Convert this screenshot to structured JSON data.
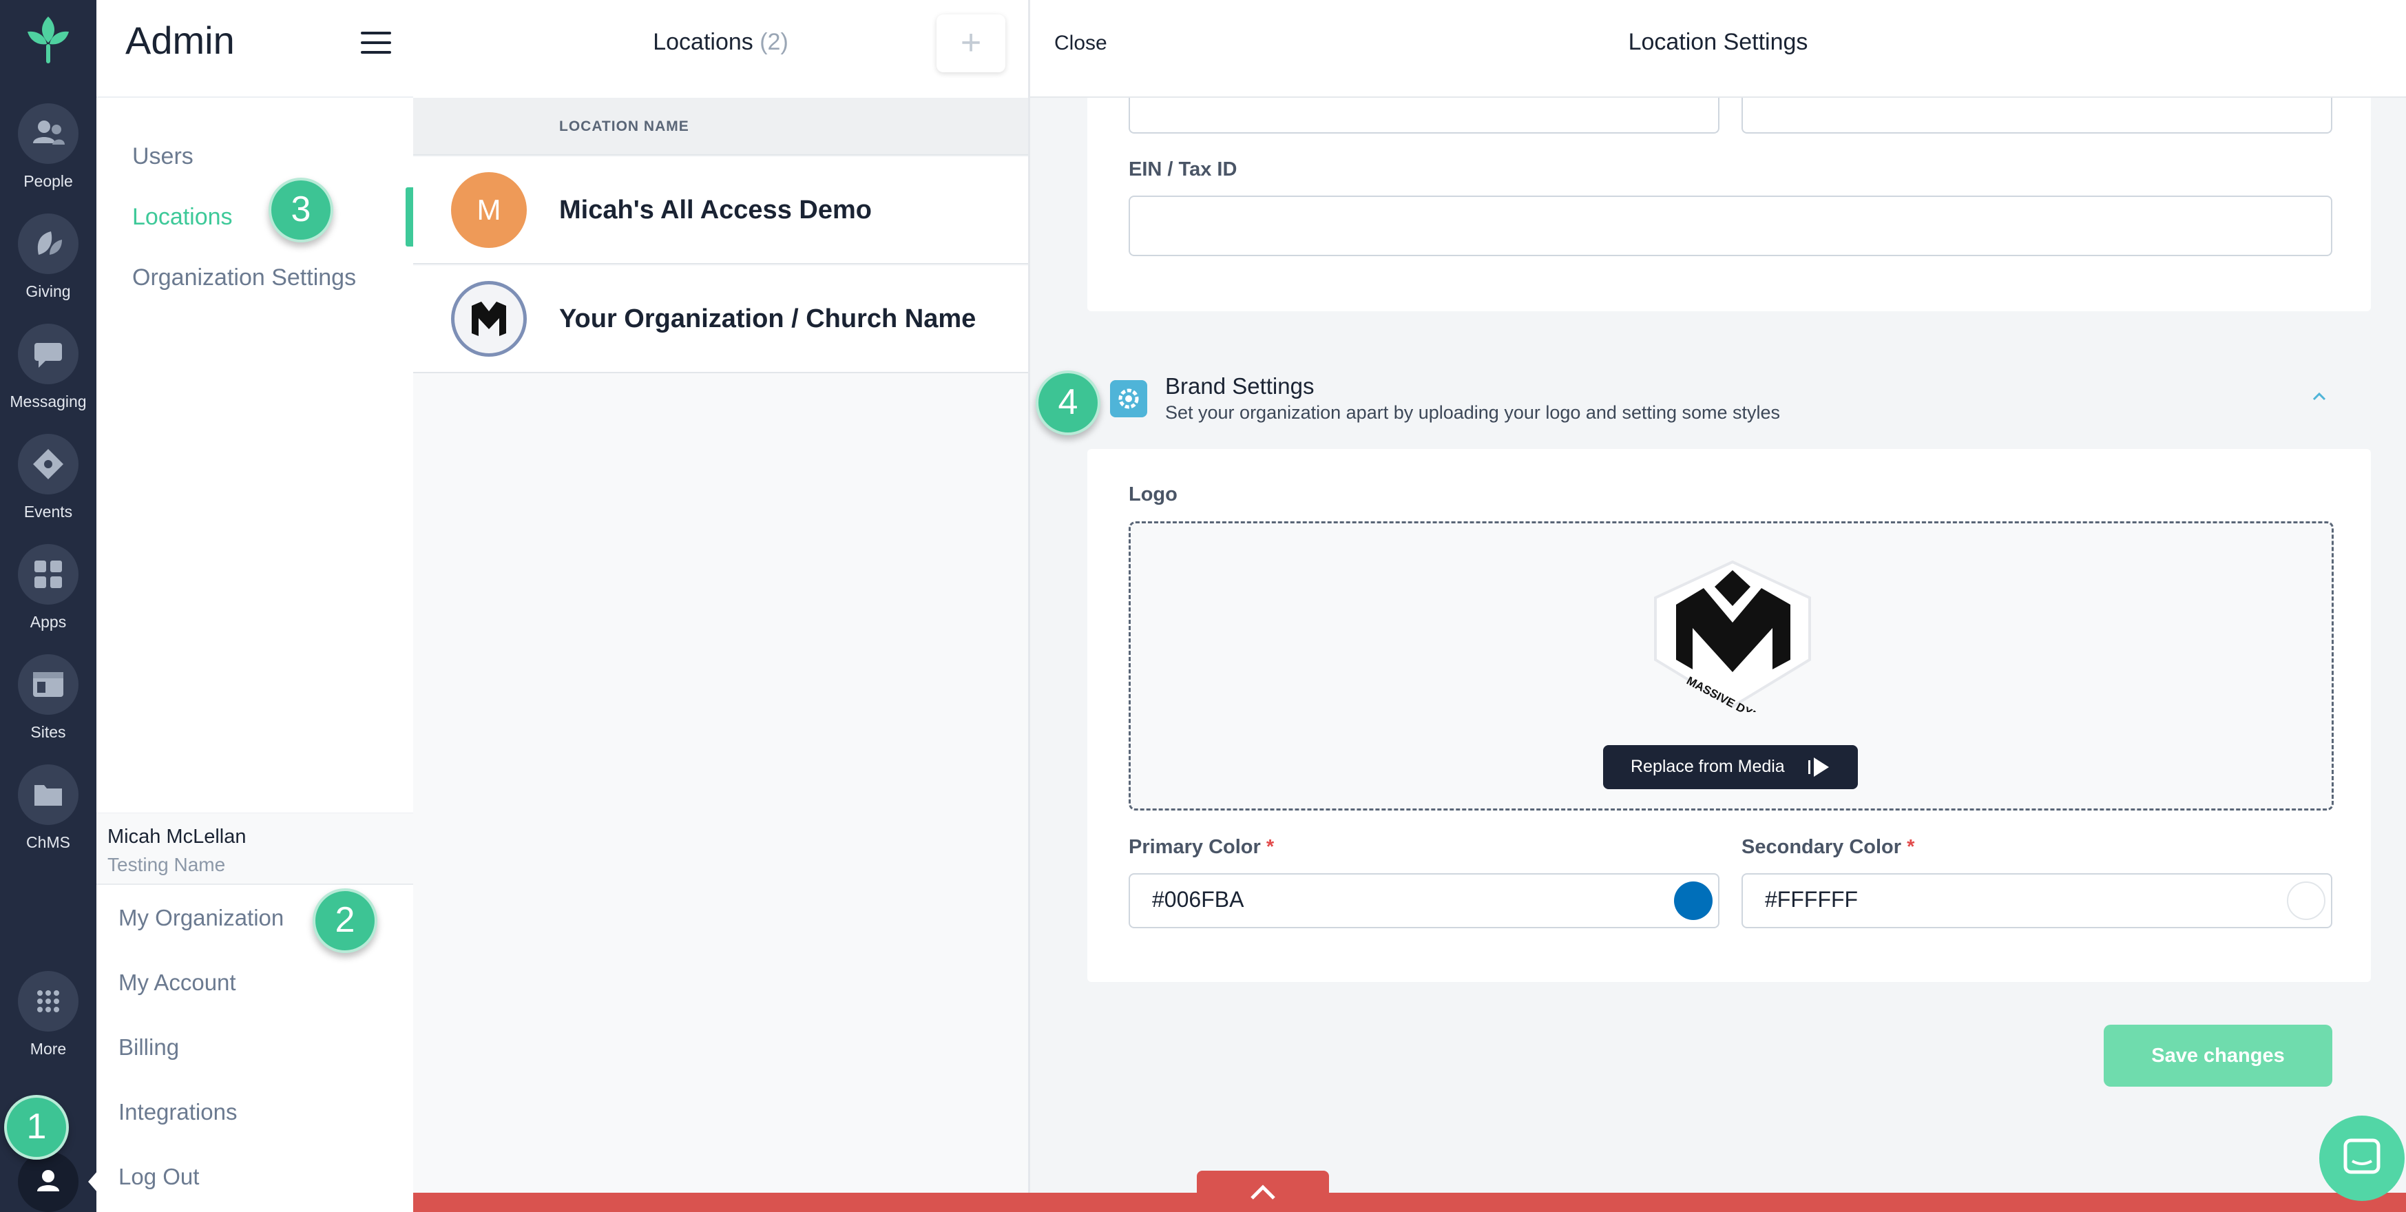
{
  "rail": {
    "items": [
      {
        "label": "People",
        "icon": "people-icon"
      },
      {
        "label": "Giving",
        "icon": "giving-leaf-icon"
      },
      {
        "label": "Messaging",
        "icon": "messaging-icon"
      },
      {
        "label": "Events",
        "icon": "events-ticket-icon"
      },
      {
        "label": "Apps",
        "icon": "apps-grid-icon"
      },
      {
        "label": "Sites",
        "icon": "sites-icon"
      },
      {
        "label": "ChMS",
        "icon": "folder-icon"
      }
    ],
    "more_label": "More"
  },
  "admin": {
    "title": "Admin",
    "menu": [
      "Users",
      "Locations",
      "Organization Settings"
    ],
    "active_menu": "Locations",
    "user": {
      "name": "Micah McLellan",
      "org": "Testing Name"
    },
    "account_menu": [
      "My Organization",
      "My Account",
      "Billing",
      "Integrations",
      "Log Out"
    ]
  },
  "locations": {
    "title": "Locations",
    "count": "(2)",
    "add_label": "+",
    "column_header": "LOCATION NAME",
    "rows": [
      {
        "initial": "M",
        "name": "Micah's All Access Demo"
      },
      {
        "initial": "",
        "name": "Your Organization / Church Name"
      }
    ]
  },
  "settings": {
    "close_label": "Close",
    "title": "Location Settings",
    "ein_label": "EIN / Tax ID",
    "ein_value": "",
    "brand": {
      "title": "Brand Settings",
      "subtitle": "Set your organization apart by uploading your logo and setting some styles",
      "logo_label": "Logo",
      "logo_text": "MASSIVE DYNAMIC",
      "replace_label": "Replace from Media",
      "primary_label": "Primary Color",
      "primary_value": "#006FBA",
      "secondary_label": "Secondary Color",
      "secondary_value": "#FFFFFF",
      "required_mark": "*"
    },
    "save_label": "Save changes"
  },
  "badges": [
    "1",
    "2",
    "3",
    "4"
  ],
  "colors": {
    "rail_bg": "#232c41",
    "accent_green": "#3ec999",
    "primary_swatch": "#006FBA",
    "secondary_swatch": "#FFFFFF",
    "save_button": "#6fdcad",
    "bottom_bar": "#d9534f"
  }
}
